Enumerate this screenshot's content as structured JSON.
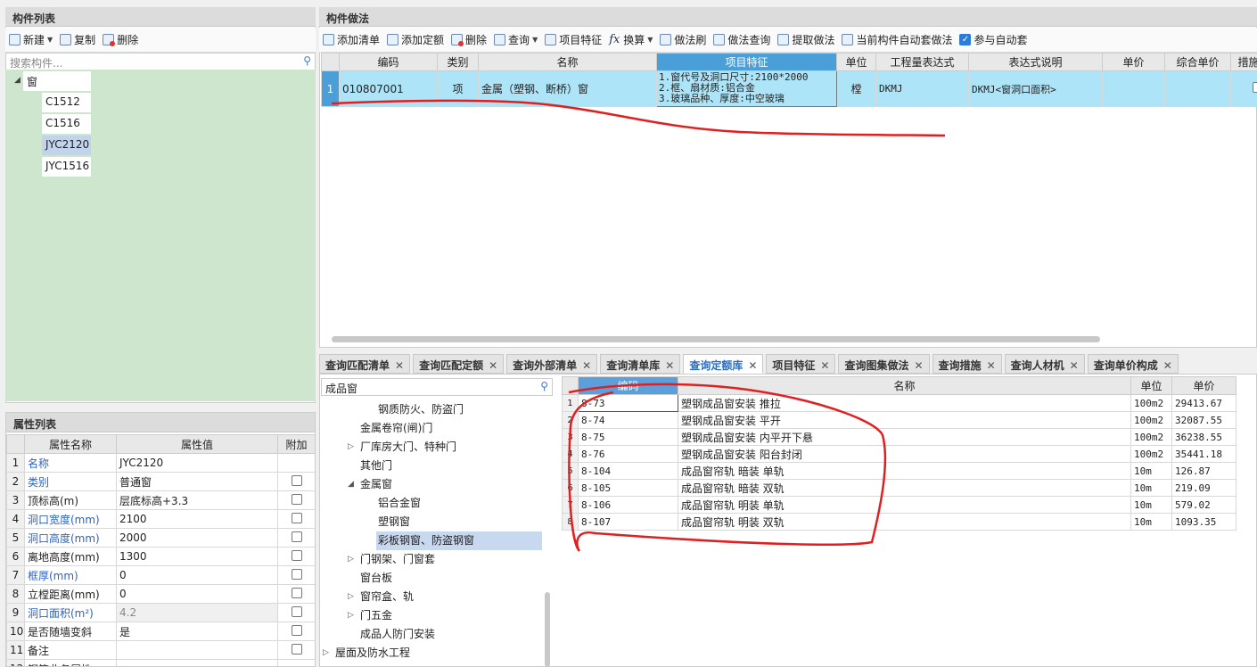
{
  "left_top": {
    "title": "构件列表",
    "toolbar": {
      "new": "新建",
      "copy": "复制",
      "delete": "删除"
    },
    "search_placeholder": "搜索构件...",
    "tree_root": "窗",
    "items": [
      "C1512",
      "C1516",
      "JYC2120",
      "JYC1516"
    ]
  },
  "props": {
    "title": "属性列表",
    "headers": {
      "name": "属性名称",
      "value": "属性值",
      "extra": "附加"
    },
    "rows": [
      {
        "n": "1",
        "name": "名称",
        "value": "JYC2120",
        "blue": true,
        "cb": false
      },
      {
        "n": "2",
        "name": "类别",
        "value": "普通窗",
        "blue": true,
        "cb": true
      },
      {
        "n": "3",
        "name": "顶标高(m)",
        "value": "层底标高+3.3",
        "blue": false,
        "cb": true
      },
      {
        "n": "4",
        "name": "洞口宽度(mm)",
        "value": "2100",
        "blue": true,
        "cb": true
      },
      {
        "n": "5",
        "name": "洞口高度(mm)",
        "value": "2000",
        "blue": true,
        "cb": true
      },
      {
        "n": "6",
        "name": "离地高度(mm)",
        "value": "1300",
        "blue": false,
        "cb": true
      },
      {
        "n": "7",
        "name": "框厚(mm)",
        "value": "0",
        "blue": true,
        "cb": true
      },
      {
        "n": "8",
        "name": "立樘距离(mm)",
        "value": "0",
        "blue": false,
        "cb": true
      },
      {
        "n": "9",
        "name": "洞口面积(m²)",
        "value": "4.2",
        "blue": true,
        "cb": true
      },
      {
        "n": "10",
        "name": "是否随墙变斜",
        "value": "是",
        "blue": false,
        "cb": true
      },
      {
        "n": "11",
        "name": "备注",
        "value": "",
        "blue": false,
        "cb": true
      },
      {
        "n": "12",
        "name": "钢筋业务属性",
        "value": "",
        "blue": false,
        "cb": false
      }
    ]
  },
  "method": {
    "title": "构件做法",
    "toolbar": [
      "添加清单",
      "添加定额",
      "删除",
      "查询",
      "项目特征",
      "换算",
      "做法刷",
      "做法查询",
      "提取做法",
      "当前构件自动套做法",
      "参与自动套"
    ],
    "headers": [
      "",
      "编码",
      "类别",
      "名称",
      "项目特征",
      "单位",
      "工程量表达式",
      "表达式说明",
      "单价",
      "综合单价",
      "措施"
    ],
    "row": {
      "n": "1",
      "code": "010807001",
      "type": "项",
      "name": "金属（塑钢、断桥）窗",
      "feature": [
        "1.窗代号及洞口尺寸:2100*2000",
        "2.框、扇材质:铝合金",
        "3.玻璃品种、厚度:中空玻璃"
      ],
      "unit": "樘",
      "expr": "DKMJ",
      "expr_desc": "DKMJ<窗洞口面积>"
    }
  },
  "tabs": [
    {
      "label": "查询匹配清单",
      "active": false
    },
    {
      "label": "查询匹配定额",
      "active": false
    },
    {
      "label": "查询外部清单",
      "active": false
    },
    {
      "label": "查询清单库",
      "active": false
    },
    {
      "label": "查询定额库",
      "active": true
    },
    {
      "label": "项目特征",
      "active": false
    },
    {
      "label": "查询图集做法",
      "active": false
    },
    {
      "label": "查询措施",
      "active": false
    },
    {
      "label": "查询人材机",
      "active": false
    },
    {
      "label": "查询单价构成",
      "active": false
    }
  ],
  "quota_search": "成品窗",
  "quota_tree": [
    {
      "label": "钢质防火、防盗门",
      "lvl": 2,
      "tri": ""
    },
    {
      "label": "金属卷帘(闸)门",
      "lvl": 1,
      "tri": ""
    },
    {
      "label": "厂库房大门、特种门",
      "lvl": 1,
      "tri": "▷"
    },
    {
      "label": "其他门",
      "lvl": 1,
      "tri": ""
    },
    {
      "label": "金属窗",
      "lvl": 1,
      "tri": "◢"
    },
    {
      "label": "铝合金窗",
      "lvl": 2,
      "tri": ""
    },
    {
      "label": "塑钢窗",
      "lvl": 2,
      "tri": ""
    },
    {
      "label": "彩板钢窗、防盗钢窗",
      "lvl": 2,
      "tri": "",
      "sel": true
    },
    {
      "label": "门钢架、门窗套",
      "lvl": 1,
      "tri": "▷"
    },
    {
      "label": "窗台板",
      "lvl": 1,
      "tri": ""
    },
    {
      "label": "窗帘盒、轨",
      "lvl": 1,
      "tri": "▷"
    },
    {
      "label": "门五金",
      "lvl": 1,
      "tri": "▷"
    },
    {
      "label": "成品人防门安装",
      "lvl": 1,
      "tri": ""
    },
    {
      "label": "屋面及防水工程",
      "lvl": 0,
      "tri": "▷"
    }
  ],
  "quota_headers": [
    "编码",
    "名称",
    "单位",
    "单价"
  ],
  "quota_rows": [
    {
      "n": "1",
      "code": "8-73",
      "name": "塑钢成品窗安装 推拉",
      "unit": "100m2",
      "price": "29413.67"
    },
    {
      "n": "2",
      "code": "8-74",
      "name": "塑钢成品窗安装 平开",
      "unit": "100m2",
      "price": "32087.55"
    },
    {
      "n": "3",
      "code": "8-75",
      "name": "塑钢成品窗安装 内平开下悬",
      "unit": "100m2",
      "price": "36238.55"
    },
    {
      "n": "4",
      "code": "8-76",
      "name": "塑钢成品窗安装 阳台封闭",
      "unit": "100m2",
      "price": "35441.18"
    },
    {
      "n": "5",
      "code": "8-104",
      "name": "成品窗帘轨 暗装 单轨",
      "unit": "10m",
      "price": "126.87"
    },
    {
      "n": "6",
      "code": "8-105",
      "name": "成品窗帘轨 暗装 双轨",
      "unit": "10m",
      "price": "219.09"
    },
    {
      "n": "7",
      "code": "8-106",
      "name": "成品窗帘轨 明装 单轨",
      "unit": "10m",
      "price": "579.02"
    },
    {
      "n": "8",
      "code": "8-107",
      "name": "成品窗帘轨 明装 双轨",
      "unit": "10m",
      "price": "1093.35"
    }
  ]
}
